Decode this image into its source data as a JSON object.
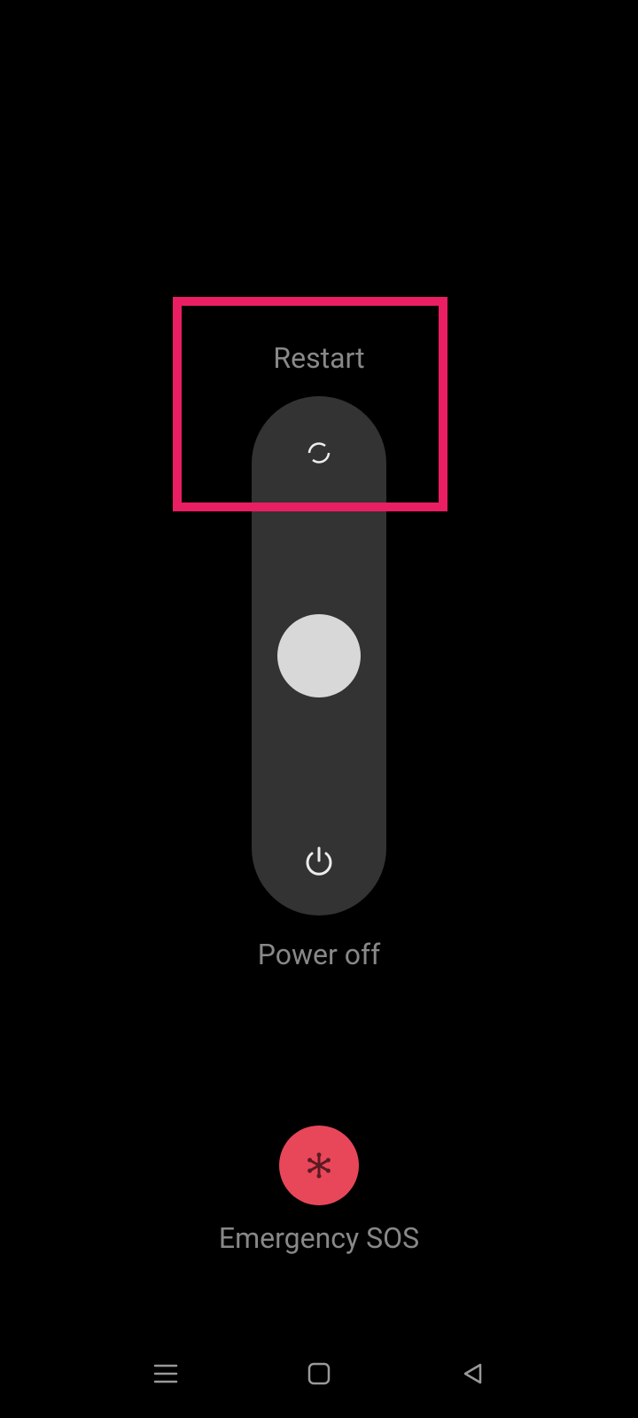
{
  "labels": {
    "restart": "Restart",
    "power_off": "Power off",
    "emergency_sos": "Emergency SOS"
  },
  "colors": {
    "sos_button": "#E84759",
    "highlight": "#E91E63",
    "track": "#333333",
    "handle": "#D8D8D8",
    "text": "#888888"
  },
  "icons": {
    "restart": "restart-icon",
    "power": "power-icon",
    "sos": "medical-asterisk-icon",
    "nav_recents": "menu-icon",
    "nav_home": "square-icon",
    "nav_back": "triangle-back-icon"
  }
}
